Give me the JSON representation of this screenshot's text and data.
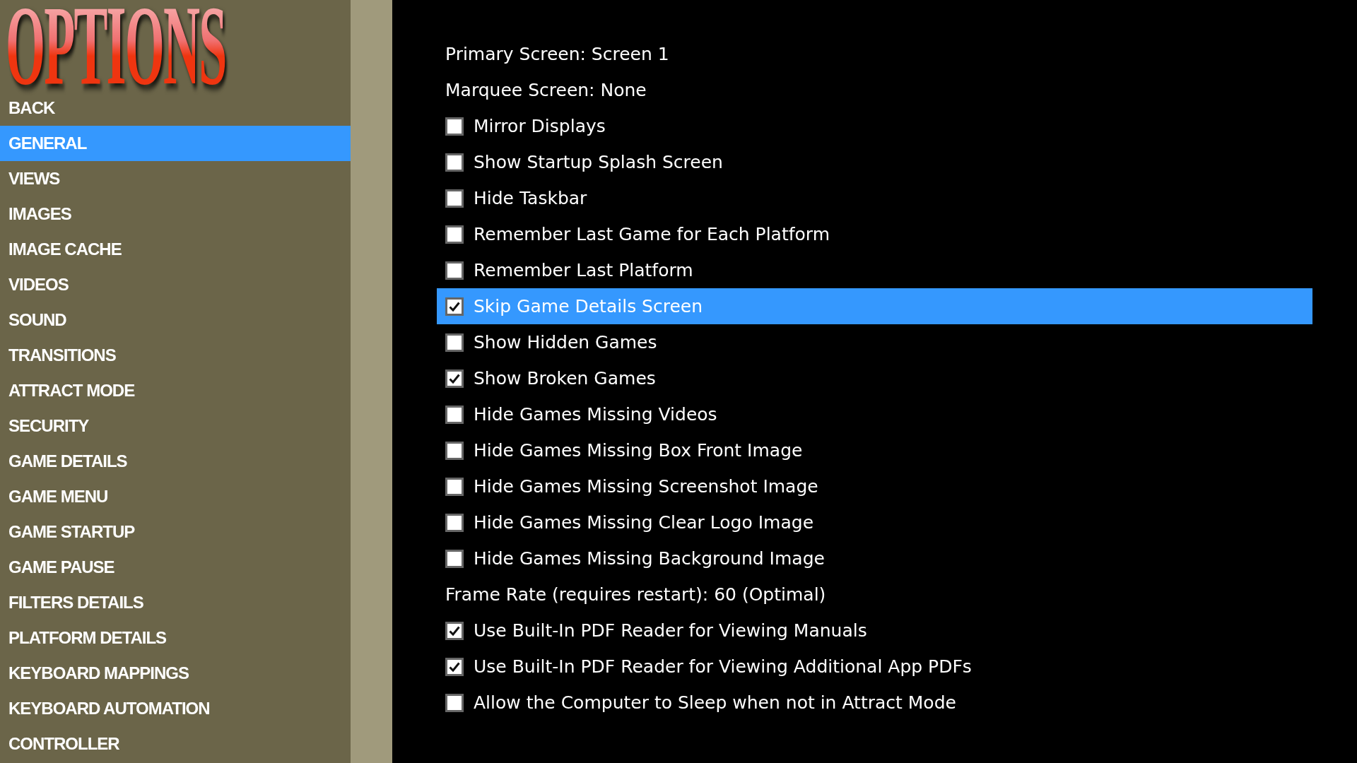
{
  "logo": {
    "title": "OPTIONS"
  },
  "sidebar": {
    "items": [
      {
        "label": "BACK",
        "selected": false
      },
      {
        "label": "GENERAL",
        "selected": true
      },
      {
        "label": "VIEWS",
        "selected": false
      },
      {
        "label": "IMAGES",
        "selected": false
      },
      {
        "label": "IMAGE CACHE",
        "selected": false
      },
      {
        "label": "VIDEOS",
        "selected": false
      },
      {
        "label": "SOUND",
        "selected": false
      },
      {
        "label": "TRANSITIONS",
        "selected": false
      },
      {
        "label": "ATTRACT MODE",
        "selected": false
      },
      {
        "label": "SECURITY",
        "selected": false
      },
      {
        "label": "GAME DETAILS",
        "selected": false
      },
      {
        "label": "GAME MENU",
        "selected": false
      },
      {
        "label": "GAME STARTUP",
        "selected": false
      },
      {
        "label": "GAME PAUSE",
        "selected": false
      },
      {
        "label": "FILTERS DETAILS",
        "selected": false
      },
      {
        "label": "PLATFORM DETAILS",
        "selected": false
      },
      {
        "label": "KEYBOARD MAPPINGS",
        "selected": false
      },
      {
        "label": "KEYBOARD AUTOMATION",
        "selected": false
      },
      {
        "label": "CONTROLLER",
        "selected": false
      }
    ]
  },
  "settings": [
    {
      "kind": "text",
      "label": "Primary Screen: Screen 1",
      "selected": false
    },
    {
      "kind": "text",
      "label": "Marquee Screen: None",
      "selected": false
    },
    {
      "kind": "checkbox",
      "label": "Mirror Displays",
      "checked": false,
      "selected": false
    },
    {
      "kind": "checkbox",
      "label": "Show Startup Splash Screen",
      "checked": false,
      "selected": false
    },
    {
      "kind": "checkbox",
      "label": "Hide Taskbar",
      "checked": false,
      "selected": false
    },
    {
      "kind": "checkbox",
      "label": "Remember Last Game for Each Platform",
      "checked": false,
      "selected": false
    },
    {
      "kind": "checkbox",
      "label": "Remember Last Platform",
      "checked": false,
      "selected": false
    },
    {
      "kind": "checkbox",
      "label": "Skip Game Details Screen",
      "checked": true,
      "selected": true
    },
    {
      "kind": "checkbox",
      "label": "Show Hidden Games",
      "checked": false,
      "selected": false
    },
    {
      "kind": "checkbox",
      "label": "Show Broken Games",
      "checked": true,
      "selected": false
    },
    {
      "kind": "checkbox",
      "label": "Hide Games Missing Videos",
      "checked": false,
      "selected": false
    },
    {
      "kind": "checkbox",
      "label": "Hide Games Missing Box Front Image",
      "checked": false,
      "selected": false
    },
    {
      "kind": "checkbox",
      "label": "Hide Games Missing Screenshot Image",
      "checked": false,
      "selected": false
    },
    {
      "kind": "checkbox",
      "label": "Hide Games Missing Clear Logo Image",
      "checked": false,
      "selected": false
    },
    {
      "kind": "checkbox",
      "label": "Hide Games Missing Background Image",
      "checked": false,
      "selected": false
    },
    {
      "kind": "text",
      "label": "Frame Rate (requires restart): 60 (Optimal)",
      "selected": false
    },
    {
      "kind": "checkbox",
      "label": "Use Built-In PDF Reader for Viewing Manuals",
      "checked": true,
      "selected": false
    },
    {
      "kind": "checkbox",
      "label": "Use Built-In PDF Reader for Viewing Additional App PDFs",
      "checked": true,
      "selected": false
    },
    {
      "kind": "checkbox",
      "label": "Allow the Computer to Sleep when not in Attract Mode",
      "checked": false,
      "selected": false
    }
  ]
}
